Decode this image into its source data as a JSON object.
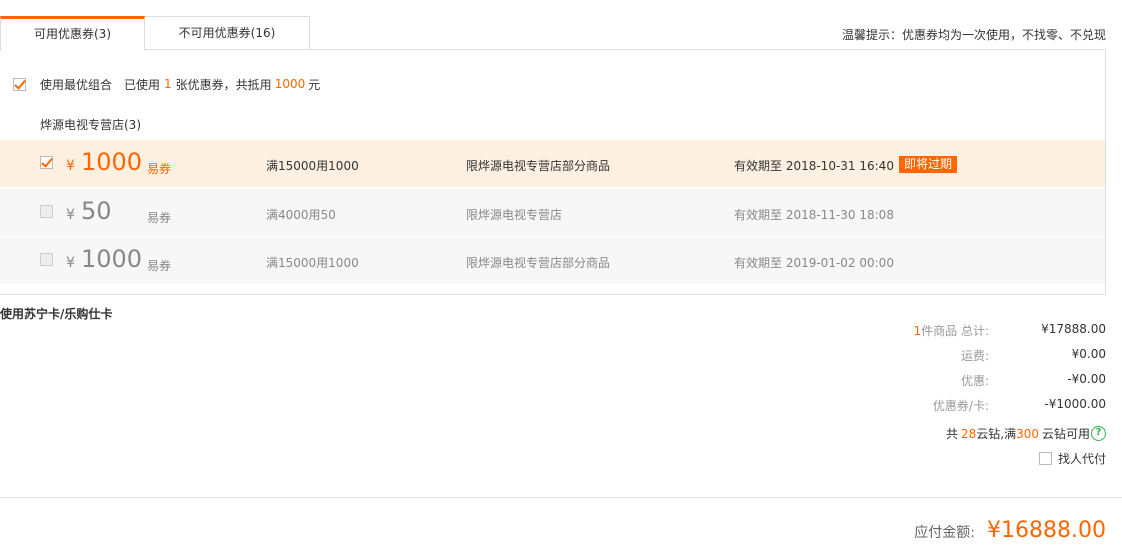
{
  "tabs": {
    "available": "可用优惠券(3)",
    "unavailable": "不可用优惠券(16)"
  },
  "tip": "温馨提示：优惠券均为一次使用，不找零、不兑现",
  "best_combo": {
    "label": "使用最优组合",
    "used_prefix": "已使用",
    "used_count": "1",
    "used_mid": "张优惠券，共抵用",
    "used_amount": "1000",
    "used_suffix": "元"
  },
  "shop": {
    "name": "烨源电视专营店(3)"
  },
  "coupons": [
    {
      "yen": "¥",
      "amount": "1000",
      "type": "易券",
      "rule": "满15000用1000",
      "scope": "限烨源电视专营店部分商品",
      "valid": "有效期至 2018-10-31 16:40",
      "badge": "即将过期",
      "checked": true
    },
    {
      "yen": "¥",
      "amount": "50",
      "type": "易券",
      "rule": "满4000用50",
      "scope": "限烨源电视专营店",
      "valid": "有效期至 2018-11-30 18:08",
      "checked": false
    },
    {
      "yen": "¥",
      "amount": "1000",
      "type": "易券",
      "rule": "满15000用1000",
      "scope": "限烨源电视专营店部分商品",
      "valid": "有效期至 2019-01-02 00:00",
      "checked": false
    }
  ],
  "card_link": "使用苏宁卡/乐购仕卡",
  "summary": {
    "items_count": "1",
    "items_label": "件商品 总计:",
    "items_value": "¥17888.00",
    "shipping_label": "运费:",
    "shipping_value": "¥0.00",
    "discount_label": "优惠:",
    "discount_value": "-¥0.00",
    "coupon_label": "优惠券/卡:",
    "coupon_value": "-¥1000.00"
  },
  "cloud": {
    "prefix": "共",
    "count": "28",
    "mid": "云钻,满",
    "threshold": "300",
    "suffix": "云钻可用",
    "help": "?"
  },
  "proxy_pay": "找人代付",
  "total": {
    "label": "应付金额:",
    "value": "¥16888.00"
  },
  "colors": {
    "accent": "#ff6600",
    "highlight_row": "#fdf0e0",
    "help_green": "#2cb14c"
  }
}
